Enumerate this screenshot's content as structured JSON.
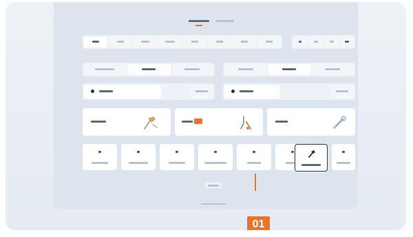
{
  "header": {
    "active_tab_label": "",
    "inactive_tab_label": ""
  },
  "row1": {
    "group_a": [
      "",
      "",
      "",
      "",
      "",
      "",
      "",
      ""
    ],
    "group_b": [
      "",
      "",
      "",
      ""
    ]
  },
  "row2": {
    "group_a": [
      "",
      "",
      ""
    ],
    "group_b": [
      "",
      "",
      ""
    ]
  },
  "row3": {
    "field_a": "",
    "button_a": "",
    "field_b": "",
    "button_b": ""
  },
  "cards": [
    {
      "label": "",
      "icon": "hammer-icon",
      "badge": false
    },
    {
      "label": "",
      "icon": "tool-icon",
      "badge": true,
      "badge_color": "#e8742c"
    },
    {
      "label": "",
      "icon": "wrench-icon",
      "badge": false
    }
  ],
  "tools": [
    {
      "label": "",
      "icon": "tool-icon"
    },
    {
      "label": "",
      "icon": "tool-icon"
    },
    {
      "label": "",
      "icon": "tool-icon"
    },
    {
      "label": "",
      "icon": "tool-icon"
    },
    {
      "label": "",
      "icon": "tool-icon"
    },
    {
      "label": "",
      "icon": "tool-icon"
    },
    {
      "label": "",
      "icon": "hammer-icon",
      "selected": true
    },
    {
      "label": "",
      "icon": "tool-icon"
    }
  ],
  "footer": {
    "button_label": ""
  },
  "callout": {
    "number": "01",
    "color": "#e8742c"
  }
}
